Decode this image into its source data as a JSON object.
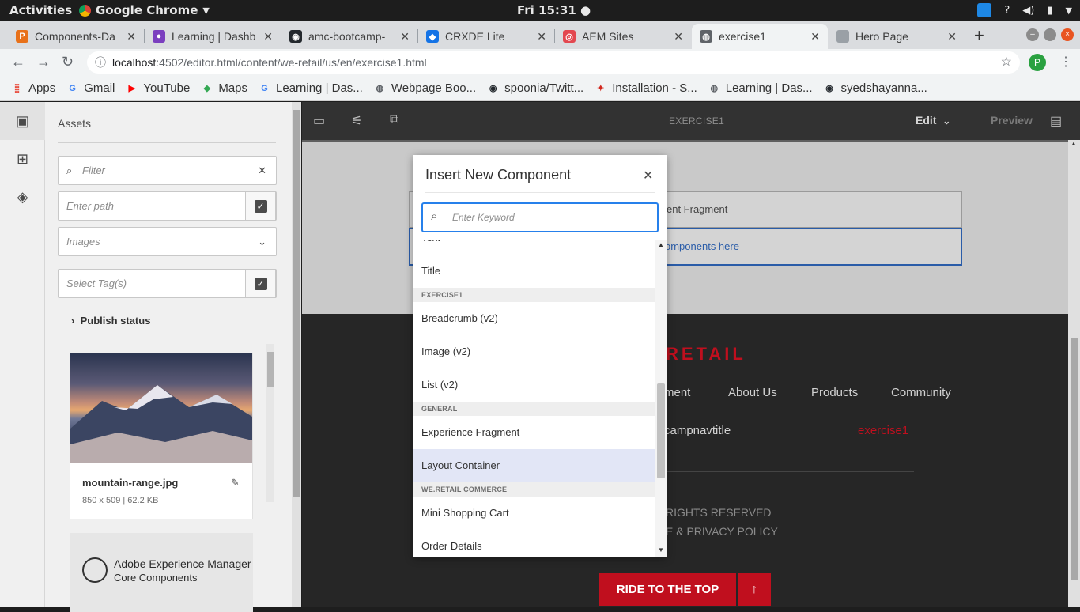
{
  "os": {
    "activities": "Activities",
    "app_name": "Google Chrome",
    "clock": "Fri 15:31",
    "tray_question": "?"
  },
  "tabs": [
    {
      "title": "Components-Da",
      "icon": "p-icon",
      "color": "#e8711a"
    },
    {
      "title": "Learning | Dashb",
      "icon": "learning-icon",
      "color": "#7b3fbf"
    },
    {
      "title": "amc-bootcamp-",
      "icon": "github-icon",
      "color": "#24292e"
    },
    {
      "title": "CRXDE Lite",
      "icon": "crxde-icon",
      "color": "#1473e6"
    },
    {
      "title": "AEM Sites",
      "icon": "aem-icon",
      "color": "#e34850"
    },
    {
      "title": "exercise1",
      "icon": "globe-icon",
      "color": "#5f6368"
    },
    {
      "title": "Hero Page",
      "icon": "blank-icon",
      "color": "#9aa0a6"
    }
  ],
  "address": {
    "host": "localhost",
    "path": ":4502/editor.html/content/we-retail/us/en/exercise1.html"
  },
  "profile_initial": "P",
  "bookmarks": [
    {
      "label": "Apps",
      "icon": "apps-grid-icon",
      "color": "#e84c3d"
    },
    {
      "label": "Gmail",
      "icon": "google-icon",
      "color": "#4285f4"
    },
    {
      "label": "YouTube",
      "icon": "youtube-icon",
      "color": "#ff0000"
    },
    {
      "label": "Maps",
      "icon": "maps-icon",
      "color": "#34a853"
    },
    {
      "label": "Learning | Das...",
      "icon": "google-icon",
      "color": "#4285f4"
    },
    {
      "label": "Webpage Boo...",
      "icon": "globe-icon",
      "color": "#5f6368"
    },
    {
      "label": "spoonia/Twitt...",
      "icon": "github-icon",
      "color": "#24292e"
    },
    {
      "label": "Installation - S...",
      "icon": "installation-icon",
      "color": "#d2281e"
    },
    {
      "label": "Learning | Das...",
      "icon": "globe-icon",
      "color": "#5f6368"
    },
    {
      "label": "syedshayanna...",
      "icon": "github-icon",
      "color": "#24292e"
    }
  ],
  "assets": {
    "title": "Assets",
    "filter_placeholder": "Filter",
    "path_placeholder": "Enter path",
    "type_value": "Images",
    "tags_placeholder": "Select Tag(s)",
    "publish_status": "Publish status",
    "asset_name": "mountain-range.jpg",
    "asset_meta": "850 x 509 | 62.2 KB",
    "aem_line1": "Adobe Experience Manager",
    "aem_line2": "Core Components"
  },
  "editor": {
    "page_title": "EXERCISE1",
    "mode": "Edit",
    "preview": "Preview"
  },
  "page": {
    "fragment_text": "ent Fragment",
    "drop_text": "omponents here",
    "brand": "RETAIL",
    "nav": [
      "ment",
      "About Us",
      "Products",
      "Community"
    ],
    "bootcamp": "campnavtitle",
    "exercise_link": "exercise1",
    "rights": "RIGHTS RESERVED",
    "license": "E & PRIVACY POLICY",
    "ride": "RIDE TO THE TOP",
    "ride_arrow": "↑"
  },
  "dialog": {
    "title": "Insert New Component",
    "search_placeholder": "Enter Keyword",
    "partial_item": "Text",
    "items": [
      {
        "type": "item",
        "label": "Title"
      },
      {
        "type": "group",
        "label": "EXERCISE1"
      },
      {
        "type": "item",
        "label": "Breadcrumb (v2)"
      },
      {
        "type": "item",
        "label": "Image (v2)"
      },
      {
        "type": "item",
        "label": "List (v2)"
      },
      {
        "type": "group",
        "label": "GENERAL"
      },
      {
        "type": "item",
        "label": "Experience Fragment"
      },
      {
        "type": "item",
        "label": "Layout Container",
        "selected": true
      },
      {
        "type": "group",
        "label": "WE.RETAIL COMMERCE"
      },
      {
        "type": "item",
        "label": "Mini Shopping Cart"
      },
      {
        "type": "item",
        "label": "Order Details"
      }
    ]
  }
}
